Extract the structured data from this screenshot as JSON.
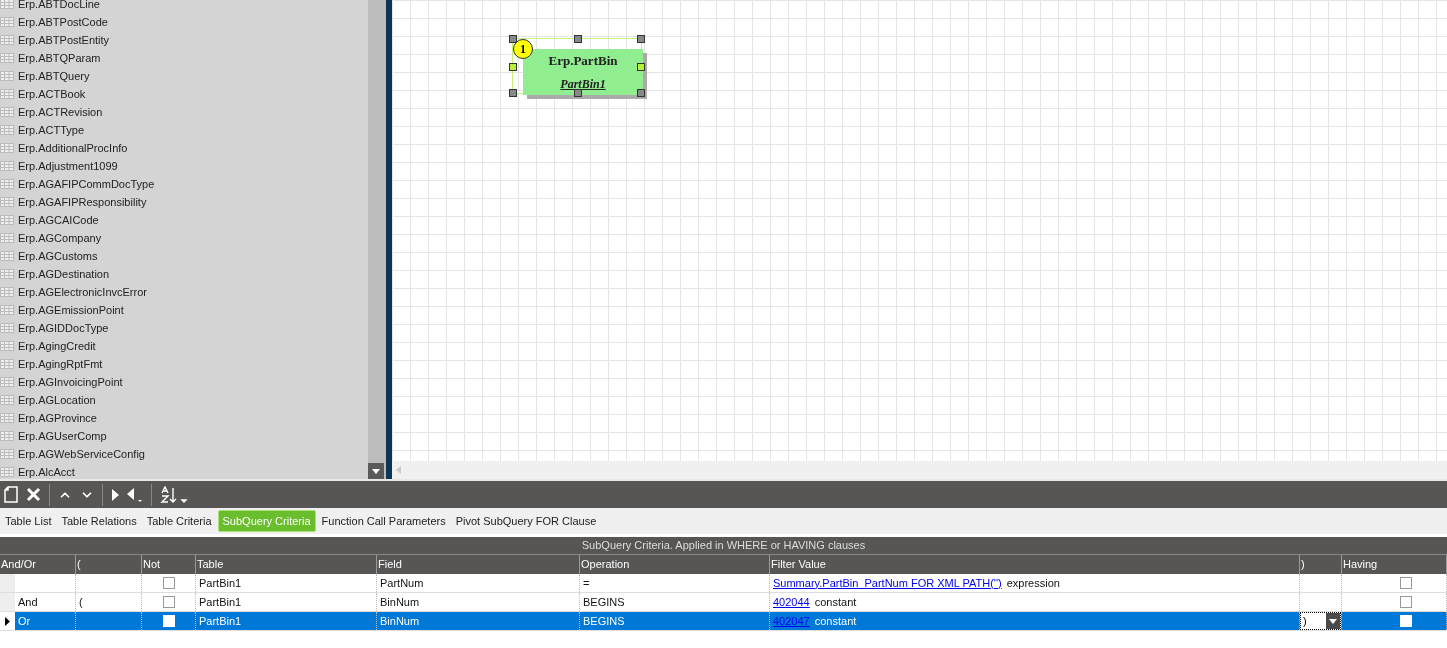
{
  "table_list": {
    "items": [
      "Erp.ABTDocLine",
      "Erp.ABTPostCode",
      "Erp.ABTPostEntity",
      "Erp.ABTQParam",
      "Erp.ABTQuery",
      "Erp.ACTBook",
      "Erp.ACTRevision",
      "Erp.ACTType",
      "Erp.AdditionalProcInfo",
      "Erp.Adjustment1099",
      "Erp.AGAFIPCommDocType",
      "Erp.AGAFIPResponsibility",
      "Erp.AGCAICode",
      "Erp.AGCompany",
      "Erp.AGCustoms",
      "Erp.AGDestination",
      "Erp.AGElectronicInvcError",
      "Erp.AGEmissionPoint",
      "Erp.AGIDDocType",
      "Erp.AgingCredit",
      "Erp.AgingRptFmt",
      "Erp.AGInvoicingPoint",
      "Erp.AGLocation",
      "Erp.AGProvince",
      "Erp.AGUserComp",
      "Erp.AGWebServiceConfig",
      "Erp.AlcAcct"
    ]
  },
  "diagram": {
    "nodes": [
      {
        "number": "1",
        "title": "Erp.PartBin",
        "alias": "PartBin1",
        "selected": true
      }
    ]
  },
  "tabs": [
    {
      "label": "Table List",
      "selected": false
    },
    {
      "label": "Table Relations",
      "selected": false
    },
    {
      "label": "Table Criteria",
      "selected": false
    },
    {
      "label": "SubQuery Criteria",
      "selected": true
    },
    {
      "label": "Function Call Parameters",
      "selected": false
    },
    {
      "label": "Pivot SubQuery FOR Clause",
      "selected": false
    }
  ],
  "grid": {
    "caption": "SubQuery Criteria. Applied in WHERE or HAVING clauses",
    "columns": [
      "And/Or",
      "(",
      "Not",
      "Table",
      "Field",
      "Operation",
      "Filter Value",
      ")",
      "Having"
    ],
    "rows": [
      {
        "and_or": "",
        "open_paren": "",
        "not": false,
        "table": "PartBin1",
        "field": "PartNum",
        "operation": "=",
        "filter_link": "Summary.PartBin_PartNum FOR XML PATH('')",
        "filter_kind": "expression",
        "close_paren": "",
        "having": false,
        "selected": false
      },
      {
        "and_or": "And",
        "open_paren": "(",
        "not": false,
        "table": "PartBin1",
        "field": "BinNum",
        "operation": "BEGINS",
        "filter_link": "402044",
        "filter_kind": "constant",
        "close_paren": "",
        "having": false,
        "selected": false
      },
      {
        "and_or": "Or",
        "open_paren": "",
        "not": false,
        "table": "PartBin1",
        "field": "BinNum",
        "operation": "BEGINS",
        "filter_link": "402047",
        "filter_kind": "constant",
        "close_paren": ")",
        "having": false,
        "selected": true
      }
    ]
  }
}
